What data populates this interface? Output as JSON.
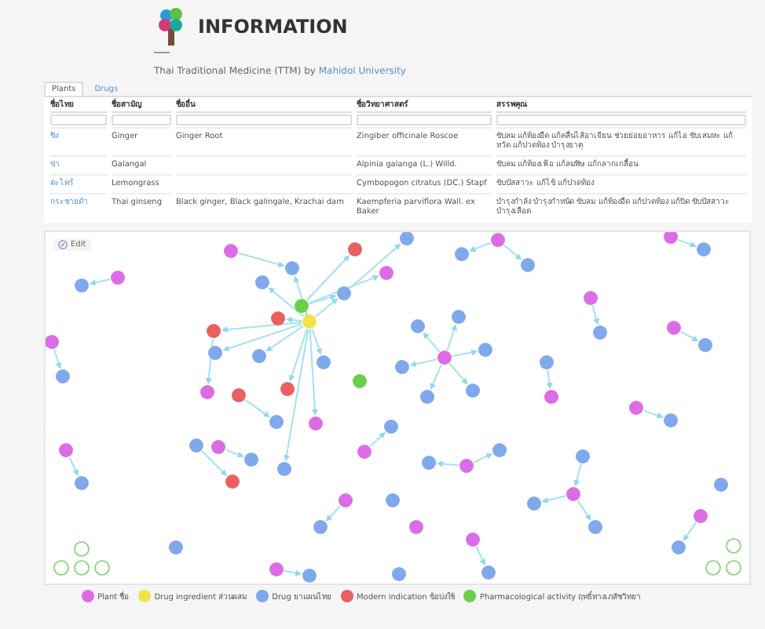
{
  "header": {
    "title": "INFORMATION",
    "subtitle": "Thai Traditional Medicine (TTM) by ",
    "subtitle_link": "Mahidol University"
  },
  "tabs": [
    {
      "label": "Plants",
      "selected": true
    },
    {
      "label": "Drugs",
      "selected": false
    }
  ],
  "table": {
    "columns": [
      "ชื่อไทย",
      "ชื่อสามัญ",
      "ชื่ออื่น",
      "ชื่อวิทยาศาสตร์",
      "สรรพคุณ"
    ],
    "rows": [
      {
        "name": "ขิง",
        "common": "Ginger",
        "other": "Ginger Root",
        "scientific": "Zingiber officinale Roscoe",
        "uses": "ขับลม แก้ท้องอืด แก้คลื่นไส้อาเจียน ช่วยย่อยอาหาร แก้ไอ ขับเสมหะ แก้หวัด แก้ปวดท้อง บำรุงธาตุ"
      },
      {
        "name": "ข่า",
        "common": "Galangal",
        "scientific": "Alpinia galanga (L.) Willd.",
        "uses": "ขับลม แก้ท้องเฟ้อ แก้ลมพิษ แก้กลากเกลื้อน"
      },
      {
        "name": "ตะไคร้",
        "common": "Lemongrass",
        "scientific": "Cymbopogon citratus (DC.) Stapf",
        "uses": "ขับปัสสาวะ แก้ไข้ แก้ปวดท้อง"
      },
      {
        "name": "กระชายดำ",
        "common": "Thai ginseng",
        "other": "Black ginger, Black galingale, Krachai dam",
        "scientific": "Kaempferia parviflora Wall. ex Baker",
        "uses": "บำรุงกำลัง บำรุงกำหนัด ขับลม แก้ท้องอืด แก้ปวดท้อง แก้บิด ขับปัสสาวะ บำรุงเลือด"
      }
    ]
  },
  "graph": {
    "edit_label": "Edit",
    "nodes": [
      {
        "kind": "plant"
      },
      {
        "kind": "indication"
      },
      {
        "kind": "drug"
      },
      {
        "kind": "plant"
      },
      {
        "kind": "plant"
      },
      {
        "kind": "drug"
      },
      {
        "kind": "drug"
      },
      {
        "kind": "drug"
      },
      {
        "kind": "drug"
      },
      {
        "kind": "plant"
      },
      {
        "kind": "drug"
      },
      {
        "kind": "plant"
      },
      {
        "kind": "drug"
      },
      {
        "kind": "drug"
      },
      {
        "kind": "activity"
      },
      {
        "kind": "plant"
      },
      {
        "kind": "indication"
      },
      {
        "kind": "ingredient"
      },
      {
        "kind": "drug"
      },
      {
        "kind": "drug"
      },
      {
        "kind": "plant"
      },
      {
        "kind": "indication"
      },
      {
        "kind": "plant"
      },
      {
        "kind": "drug"
      },
      {
        "kind": "drug"
      },
      {
        "kind": "drug"
      },
      {
        "kind": "plant"
      },
      {
        "kind": "drug"
      },
      {
        "kind": "drug"
      },
      {
        "kind": "drug"
      },
      {
        "kind": "drug"
      },
      {
        "kind": "drug"
      },
      {
        "kind": "drug"
      },
      {
        "kind": "activity"
      },
      {
        "kind": "plant"
      },
      {
        "kind": "indication"
      },
      {
        "kind": "indication"
      },
      {
        "kind": "drug"
      },
      {
        "kind": "drug"
      },
      {
        "kind": "plant"
      },
      {
        "kind": "plant"
      },
      {
        "kind": "drug"
      },
      {
        "kind": "plant"
      },
      {
        "kind": "drug"
      },
      {
        "kind": "drug"
      },
      {
        "kind": "plant"
      },
      {
        "kind": "drug"
      },
      {
        "kind": "plant"
      },
      {
        "kind": "drug"
      },
      {
        "kind": "plant"
      },
      {
        "kind": "drug"
      },
      {
        "kind": "plant"
      },
      {
        "kind": "drug"
      },
      {
        "kind": "drug"
      },
      {
        "kind": "drug"
      },
      {
        "kind": "indication"
      },
      {
        "kind": "drug"
      },
      {
        "kind": "drug"
      },
      {
        "kind": "plant"
      },
      {
        "kind": "drug"
      },
      {
        "kind": "plant"
      },
      {
        "kind": "drug"
      },
      {
        "kind": "plant"
      },
      {
        "kind": "drug"
      },
      {
        "kind": "plant"
      },
      {
        "kind": "drug"
      },
      {
        "kind": "plant"
      },
      {
        "kind": "drug"
      },
      {
        "kind": "drug"
      },
      {
        "kind": "drug"
      },
      {
        "kind": "plant"
      },
      {
        "kind": "drug"
      },
      {
        "kind": "drug"
      }
    ]
  },
  "legend": [
    {
      "kind": "plant",
      "label": "Plant ชื่อ",
      "color": "#dc6ce6"
    },
    {
      "kind": "ingredient",
      "label": "Drug ingredient ส่วนผสม",
      "color": "#f2e24a"
    },
    {
      "kind": "drug",
      "label": "Drug ยาแผนไทย",
      "color": "#80a8ec"
    },
    {
      "kind": "indication",
      "label": "Modern indication ข้อบ่งใช้",
      "color": "#ea5f5f"
    },
    {
      "kind": "activity",
      "label": "Pharmacological activity ฤทธิ์ทางเภสัชวิทยา",
      "color": "#6bcf4b"
    }
  ]
}
